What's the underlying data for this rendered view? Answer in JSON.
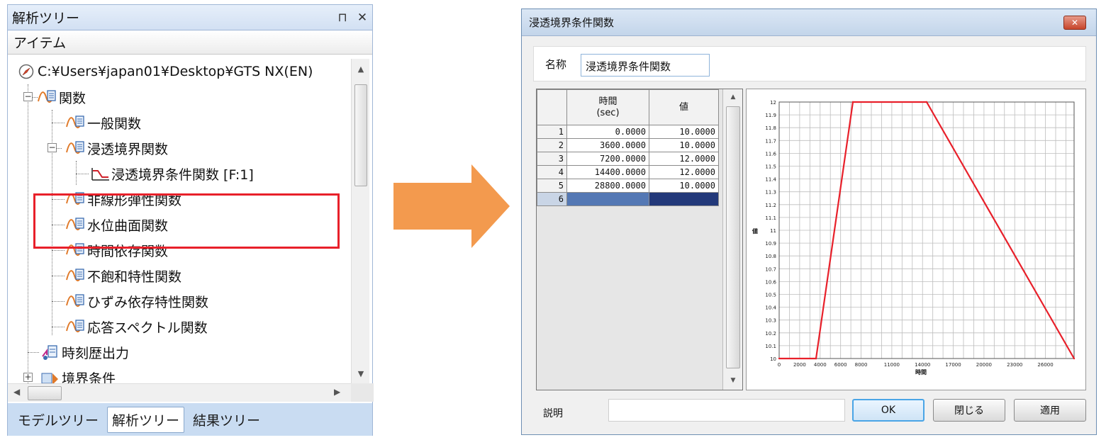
{
  "tree_panel": {
    "title": "解析ツリー",
    "pin_icon": "pin-icon",
    "close_icon": "close-icon",
    "column_header": "アイテム",
    "root": "C:¥Users¥japan01¥Desktop¥GTS NX(EN)",
    "items": [
      {
        "label": "関数",
        "icon": "function-folder-icon"
      },
      {
        "label": "一般関数",
        "icon": "function-icon"
      },
      {
        "label": "浸透境界関数",
        "icon": "function-icon"
      },
      {
        "label": "浸透境界条件関数 [F:1]",
        "icon": "curve-icon"
      },
      {
        "label": "非線形弾性関数",
        "icon": "function-icon"
      },
      {
        "label": "水位曲面関数",
        "icon": "function-icon"
      },
      {
        "label": "時間依存関数",
        "icon": "function-icon"
      },
      {
        "label": "不飽和特性関数",
        "icon": "function-icon"
      },
      {
        "label": "ひずみ依存特性関数",
        "icon": "function-icon"
      },
      {
        "label": "応答スペクトル関数",
        "icon": "function-icon"
      },
      {
        "label": "時刻歴出力",
        "icon": "time-history-icon"
      },
      {
        "label": "境界条件",
        "icon": "boundary-icon"
      }
    ],
    "tabs": [
      {
        "label": "モデルツリー",
        "active": false
      },
      {
        "label": "解析ツリー",
        "active": true
      },
      {
        "label": "結果ツリー",
        "active": false
      }
    ]
  },
  "dialog": {
    "title": "浸透境界条件関数",
    "name_label": "名称",
    "name_value": "浸透境界条件関数",
    "table": {
      "col_time": "時間\n(sec)",
      "col_value": "値",
      "rows": [
        {
          "no": "1",
          "time": "0.0000",
          "value": "10.0000"
        },
        {
          "no": "2",
          "time": "3600.0000",
          "value": "10.0000"
        },
        {
          "no": "3",
          "time": "7200.0000",
          "value": "12.0000"
        },
        {
          "no": "4",
          "time": "14400.0000",
          "value": "12.0000"
        },
        {
          "no": "5",
          "time": "28800.0000",
          "value": "10.0000"
        },
        {
          "no": "6",
          "time": "",
          "value": ""
        }
      ]
    },
    "desc_label": "説明",
    "buttons": {
      "ok": "OK",
      "close": "閉じる",
      "apply": "適用"
    },
    "accent_color": "#e8202a"
  },
  "chart_data": {
    "type": "line",
    "xlabel": "時間",
    "ylabel": "値",
    "x": [
      0,
      3600,
      7200,
      14400,
      28800
    ],
    "series": [
      {
        "values": [
          10,
          10,
          12,
          12,
          10
        ],
        "color": "#e8202a"
      }
    ],
    "xlim": [
      0,
      28800
    ],
    "ylim": [
      10,
      12
    ],
    "xticks": [
      "0",
      "2000",
      "4000",
      "6000",
      "8000",
      "11000",
      "14000",
      "17000",
      "20000",
      "23000",
      "26000"
    ],
    "xtick_values": [
      0,
      2000,
      4000,
      6000,
      8000,
      11000,
      14000,
      17000,
      20000,
      23000,
      26000
    ],
    "yticks": [
      "10",
      "10.1",
      "10.2",
      "10.3",
      "10.4",
      "10.5",
      "10.6",
      "10.7",
      "10.8",
      "10.9",
      "11",
      "11.1",
      "11.2",
      "11.3",
      "11.4",
      "11.5",
      "11.6",
      "11.7",
      "11.8",
      "11.9",
      "12"
    ],
    "grid": true
  }
}
